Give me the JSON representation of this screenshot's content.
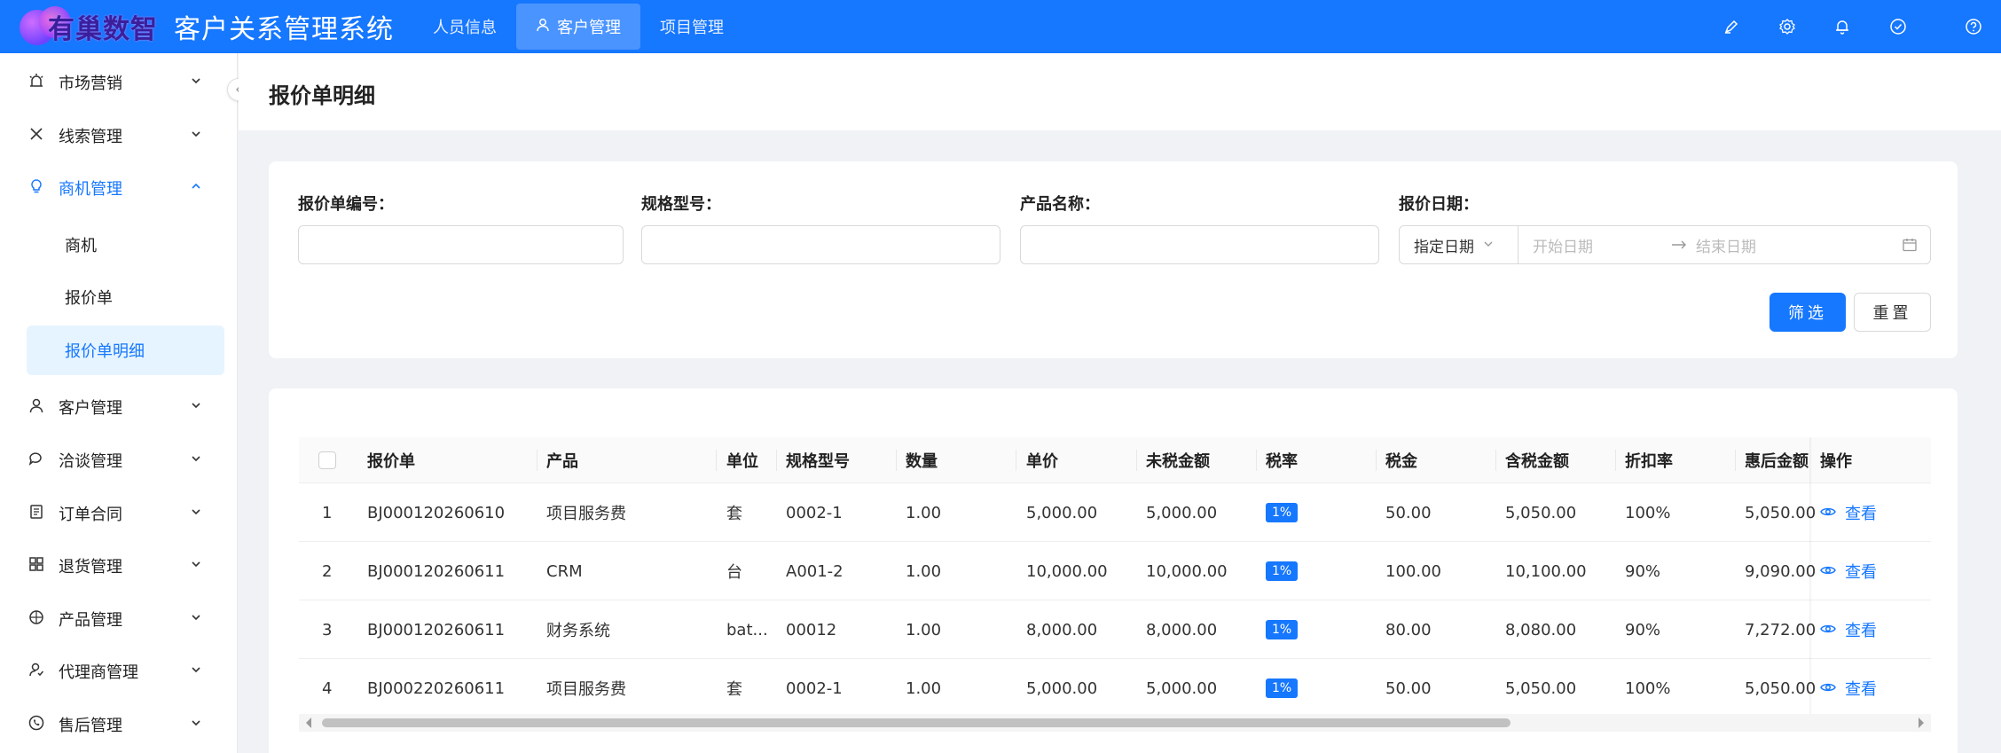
{
  "header": {
    "logo_text": "有巢数智",
    "app_title": "客户关系管理系统",
    "nav": [
      {
        "label": "人员信息"
      },
      {
        "label": "客户管理"
      },
      {
        "label": "项目管理"
      }
    ],
    "icons": [
      "pen-icon",
      "gear-icon",
      "bell-icon",
      "check-circle-icon",
      "help-icon",
      "user-icon"
    ]
  },
  "sidebar": {
    "items": [
      {
        "label": "市场营销",
        "icon": "alarm-icon"
      },
      {
        "label": "线索管理",
        "icon": "x-icon"
      },
      {
        "label": "商机管理",
        "icon": "bulb-icon"
      },
      {
        "label": "客户管理",
        "icon": "user-icon"
      },
      {
        "label": "洽谈管理",
        "icon": "chat-icon"
      },
      {
        "label": "订单合同",
        "icon": "document-icon"
      },
      {
        "label": "退货管理",
        "icon": "return-icon"
      },
      {
        "label": "产品管理",
        "icon": "product-icon"
      },
      {
        "label": "代理商管理",
        "icon": "agent-icon"
      },
      {
        "label": "售后管理",
        "icon": "phone-icon"
      }
    ],
    "sub_items": [
      {
        "label": "商机"
      },
      {
        "label": "报价单"
      },
      {
        "label": "报价单明细"
      }
    ]
  },
  "page": {
    "title": "报价单明细"
  },
  "filters": {
    "quote_no_label": "报价单编号：",
    "spec_label": "规格型号：",
    "product_label": "产品名称：",
    "date_label": "报价日期：",
    "date_type": "指定日期",
    "start_placeholder": "开始日期",
    "end_placeholder": "结束日期",
    "filter_button": "筛选",
    "reset_button": "重置"
  },
  "table": {
    "columns": [
      "报价单",
      "产品",
      "单位",
      "规格型号",
      "数量",
      "单价",
      "未税金额",
      "税率",
      "税金",
      "含税金额",
      "折扣率",
      "惠后金额",
      "操作"
    ],
    "rows": [
      {
        "index": "1",
        "quote": "BJ000120260610",
        "product": "项目服务费",
        "unit": "套",
        "spec": "0002-1",
        "qty": "1.00",
        "price": "5,000.00",
        "pretax": "5,000.00",
        "rate": "1%",
        "tax": "50.00",
        "total": "5,050.00",
        "discount": "100%",
        "final": "5,050.00",
        "action": "查看"
      },
      {
        "index": "2",
        "quote": "BJ000120260611",
        "product": "CRM",
        "unit": "台",
        "spec": "A001-2",
        "qty": "1.00",
        "price": "10,000.00",
        "pretax": "10,000.00",
        "rate": "1%",
        "tax": "100.00",
        "total": "10,100.00",
        "discount": "90%",
        "final": "9,090.00",
        "action": "查看"
      },
      {
        "index": "3",
        "quote": "BJ000120260611",
        "product": "财务系统",
        "unit": "bat...",
        "spec": "00012",
        "qty": "1.00",
        "price": "8,000.00",
        "pretax": "8,000.00",
        "rate": "1%",
        "tax": "80.00",
        "total": "8,080.00",
        "discount": "90%",
        "final": "7,272.00",
        "action": "查看"
      },
      {
        "index": "4",
        "quote": "BJ000220260611",
        "product": "项目服务费",
        "unit": "套",
        "spec": "0002-1",
        "qty": "1.00",
        "price": "5,000.00",
        "pretax": "5,000.00",
        "rate": "1%",
        "tax": "50.00",
        "total": "5,050.00",
        "discount": "100%",
        "final": "5,050.00",
        "action": "查看"
      }
    ]
  },
  "colors": {
    "primary": "#1677ff",
    "active_bg": "#e6f4ff"
  }
}
